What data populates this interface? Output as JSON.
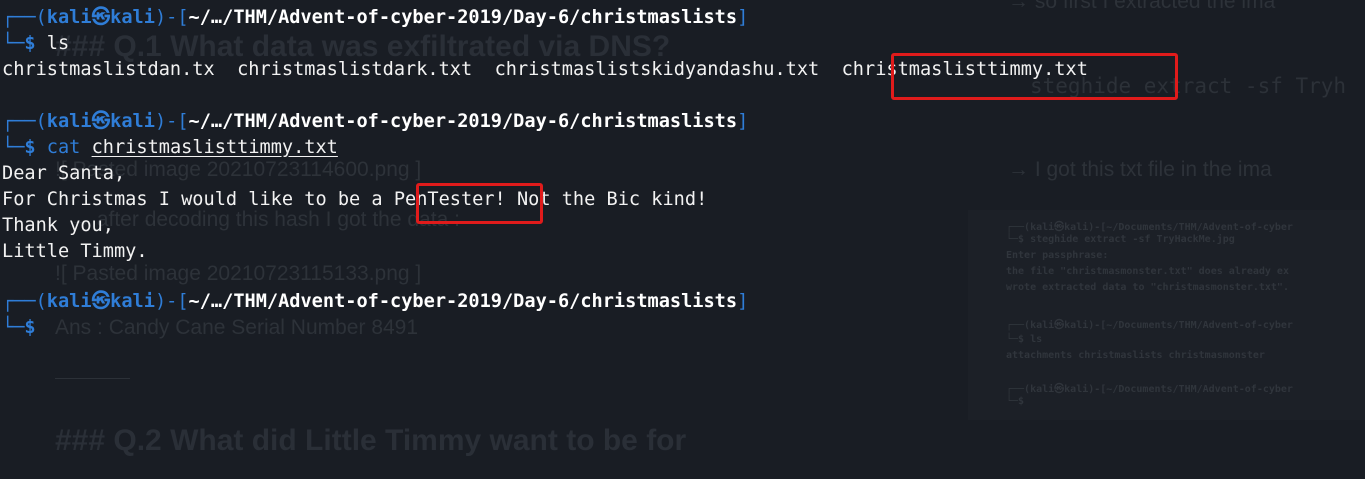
{
  "background_notes": {
    "arrow_line_1": "→ so first I extracted the ima",
    "heading_q1": "### Q.1 What data was exfiltrated via DNS?",
    "command_line": "steghide extract -sf Tryh",
    "pasted_image_1": "![ Pasted image 20210723114600.png ]",
    "arrow_line_2": "→ I got this txt file in the ima",
    "after_decoding": "→ after decoding this hash I got the data :",
    "pasted_image_2": "![ Pasted image 20210723115133.png ]",
    "answer_line": "Ans : Candy Cane Serial Number 8491",
    "heading_q2": "### Q.2 What did Little Timmy want to be for",
    "thumbnail_lines": [
      "┌──(kali㉿kali)-[~/Documents/THM/Advent-of-cyber",
      "└─$ steghide extract -sf TryHackMe.jpg",
      "Enter passphrase:",
      "the file \"christmasmonster.txt\" does already ex",
      "wrote extracted data to \"christmasmonster.txt\".",
      "┌──(kali㉿kali)-[~/Documents/THM/Advent-of-cyber",
      "└─$ ls",
      "attachments  christmaslists  christmasmonster",
      "┌──(kali㉿kali)-[~/Documents/THM/Advent-of-cyber",
      "└─$"
    ]
  },
  "terminal": {
    "prompt": {
      "frame_open": "┌──(",
      "user": "kali",
      "at_symbol": "㉿",
      "host": "kali",
      "bracket_open": ")-[",
      "path": "~/…/THM/Advent-of-cyber-2019/Day-6/christmaslists",
      "bracket_close": "]",
      "frame_input": "└─",
      "dollar": "$"
    },
    "commands": {
      "ls": "ls",
      "cat": "cat",
      "cat_arg": "christmaslisttimmy.txt"
    },
    "ls_output": [
      "christmaslistdan.tx",
      "christmaslistdark.txt",
      "christmaslistskidyandashu.txt",
      "christmaslisttimmy.txt"
    ],
    "file_lines": {
      "line1": "Dear Santa,",
      "line2_before": "For Christmas I would like to be a ",
      "line2_highlight": "PenTester!",
      "line2_after": " Not the Bic kind!",
      "line3": "Thank you,",
      "line4": "Little Timmy."
    }
  },
  "colors": {
    "background": "#191d24",
    "prompt_blue": "#2f7dd7",
    "text": "#f2f2f2",
    "highlight_red": "#e01b1b"
  }
}
